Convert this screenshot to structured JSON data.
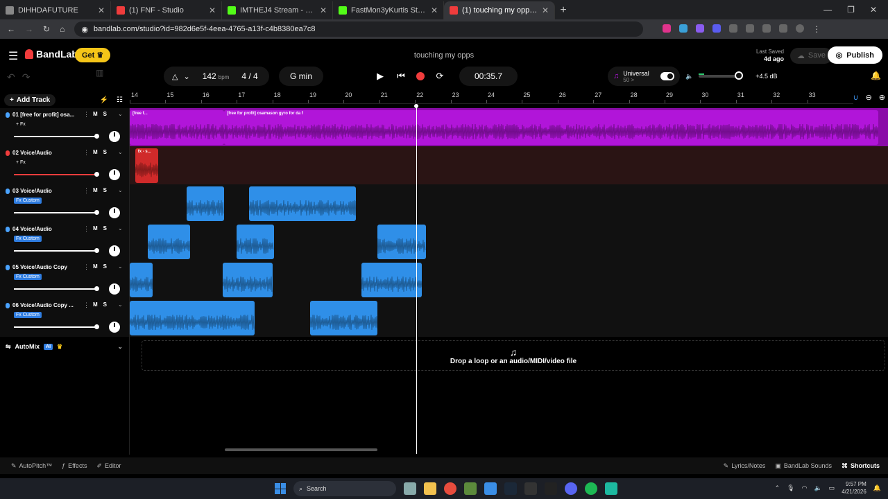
{
  "browser": {
    "tabs": [
      {
        "title": "DIHHDAFUTURE",
        "color": "#888888"
      },
      {
        "title": "(1) FNF - Studio",
        "color": "#f03c3c"
      },
      {
        "title": "IMTHEJ4 Stream - Watch Live o",
        "color": "#53fc18"
      },
      {
        "title": "FastMon3yKurtis Stream - Watc",
        "color": "#53fc18"
      },
      {
        "title": "(1) touching my opps - Stu",
        "color": "#f03c3c",
        "active": true
      }
    ],
    "url": "bandlab.com/studio?id=982d6e5f-4eea-4765-a13f-c4b8380ea7c8"
  },
  "app": {
    "brand": "BandLab",
    "get_label": "Get",
    "project_title": "touching my opps",
    "last_saved_label": "Last Saved",
    "last_saved_value": "4d ago",
    "save_label": "Save",
    "publish_label": "Publish"
  },
  "transport": {
    "bpm": "142",
    "bpm_unit": "bpm",
    "time_signature": "4 / 4",
    "key": "G min",
    "time": "00:35.7",
    "universal_label": "Universal",
    "universal_sub": "50 >",
    "master_gain": "+4.5 dB"
  },
  "timeline": {
    "bars": [
      "14",
      "15",
      "16",
      "17",
      "18",
      "19",
      "20",
      "21",
      "22",
      "23",
      "24",
      "25",
      "26",
      "27",
      "28",
      "29",
      "30",
      "31",
      "32",
      "33"
    ],
    "add_track_label": "Add Track"
  },
  "tracks": [
    {
      "name": "01 [free for profit] osa...",
      "fx": "+ Fx",
      "fx_custom": false,
      "color": "purple",
      "clips": [
        {
          "label": "[free f...",
          "start": 14.0,
          "end": 16.65
        },
        {
          "label": "[free for profit] osamason gyro for da f",
          "start": 16.65,
          "end": 35.0
        }
      ]
    },
    {
      "name": "02 Voice/Audio",
      "fx": "+ Fx",
      "fx_custom": false,
      "color": "red",
      "clips": [
        {
          "label": "fx - s...",
          "start": 14.15,
          "end": 14.8
        }
      ]
    },
    {
      "name": "03 Voice/Audio",
      "fx": "Fx Custom",
      "fx_custom": true,
      "color": "blue",
      "clips": [
        {
          "label": "",
          "start": 15.6,
          "end": 16.65
        },
        {
          "label": "",
          "start": 17.35,
          "end": 20.35
        }
      ]
    },
    {
      "name": "04 Voice/Audio",
      "fx": "Fx Custom",
      "fx_custom": true,
      "color": "blue",
      "clips": [
        {
          "label": "",
          "start": 14.5,
          "end": 15.7
        },
        {
          "label": "",
          "start": 17.0,
          "end": 18.05
        },
        {
          "label": "",
          "start": 20.95,
          "end": 22.3
        }
      ]
    },
    {
      "name": "05 Voice/Audio Copy",
      "fx": "Fx Custom",
      "fx_custom": true,
      "color": "blue",
      "clips": [
        {
          "label": "",
          "start": 14.0,
          "end": 14.65
        },
        {
          "label": "",
          "start": 16.6,
          "end": 18.0
        },
        {
          "label": "",
          "start": 20.5,
          "end": 22.2
        }
      ]
    },
    {
      "name": "06 Voice/Audio Copy ...",
      "fx": "Fx Custom",
      "fx_custom": true,
      "color": "blue",
      "clips": [
        {
          "label": "",
          "start": 14.0,
          "end": 17.5
        },
        {
          "label": "",
          "start": 19.05,
          "end": 20.95
        }
      ]
    }
  ],
  "automix": {
    "label": "AutoMix",
    "badge": "AI"
  },
  "dropzone": {
    "text": "Drop a loop or an audio/MIDI/video file"
  },
  "playhead_bar": 22.0,
  "bottom": {
    "left": [
      "AutoPitch™",
      "Effects",
      "Editor"
    ],
    "right": [
      "Lyrics/Notes",
      "BandLab Sounds",
      "Shortcuts"
    ]
  },
  "taskbar": {
    "search": "Search",
    "time": "9:57 PM",
    "date": "4/21/2026"
  }
}
